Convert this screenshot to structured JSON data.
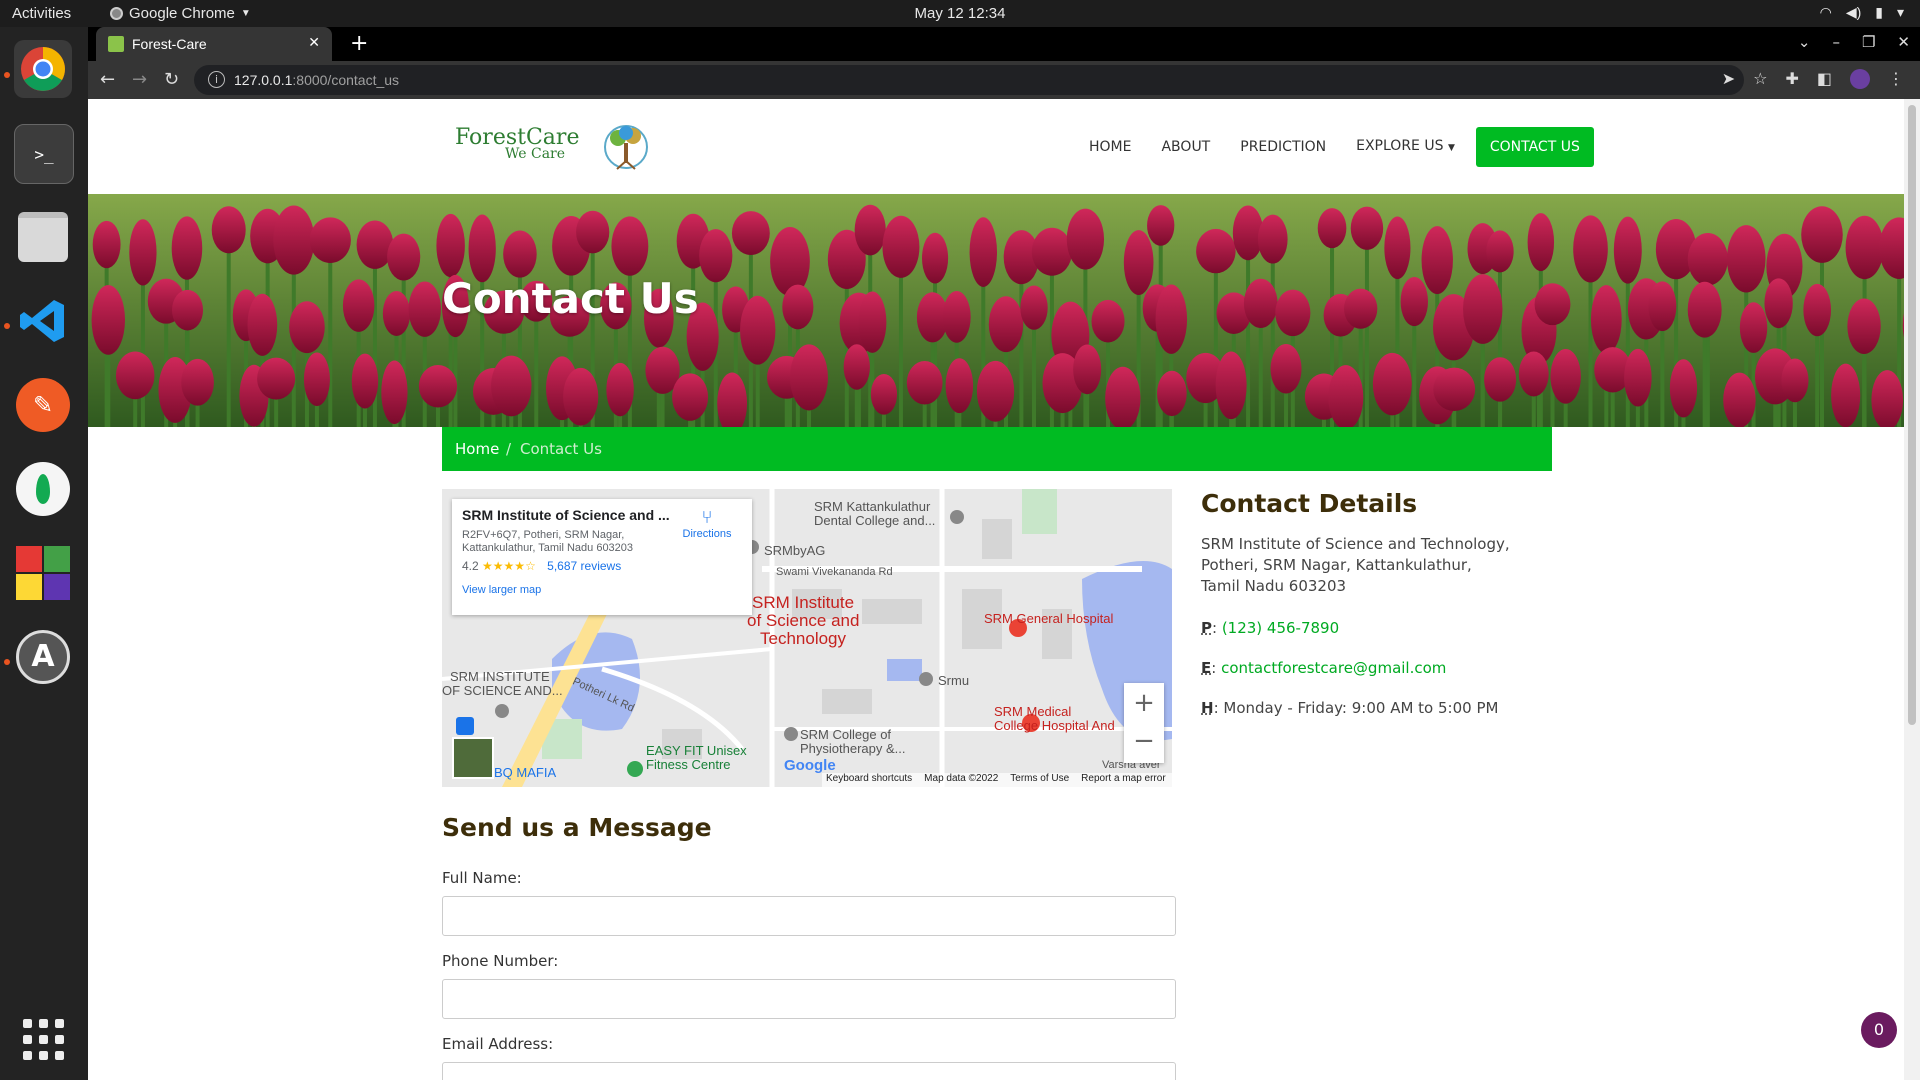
{
  "os": {
    "activities": "Activities",
    "app_name": "Google Chrome",
    "clock": "May 12  12:34"
  },
  "browser": {
    "tab_title": "Forest-Care",
    "url_host": "127.0.0.1",
    "url_path": ":8000/contact_us"
  },
  "site": {
    "logo_line1": "ForestCare",
    "logo_line2": "We Care",
    "nav": {
      "home": "HOME",
      "about": "ABOUT",
      "prediction": "PREDICTION",
      "explore": "EXPLORE US",
      "contact": "CONTACT US"
    },
    "hero_title": "Contact Us",
    "breadcrumb": {
      "home": "Home",
      "sep": "/",
      "current": "Contact Us"
    }
  },
  "map": {
    "place_name": "SRM Institute of Science and ...",
    "address_line1": "R2FV+6Q7, Potheri, SRM Nagar,",
    "address_line2": "Kattankulathur, Tamil Nadu 603203",
    "rating": "4.2",
    "stars": "★★★★☆",
    "reviews": "5,687 reviews",
    "directions": "Directions",
    "larger_map": "View larger map",
    "labels": {
      "l1": "SRM Kattankulathur",
      "l2": "Dental College and...",
      "l3": "SRMbyAG",
      "l4": "Swami Vivekananda Rd",
      "l5": "SRM Institute",
      "l6": "of Science and",
      "l7": "Technology",
      "l8": "SRM General Hospital",
      "l9": "SRM INSTITUTE",
      "l10": "OF SCIENCE AND...",
      "l11": "Potheri Lk Rd",
      "l12": "Srmu",
      "l13": "SRM Medical",
      "l14": "College Hospital And",
      "l15": "SRM College of",
      "l16": "Physiotherapy &...",
      "l17": "EASY FIT Unisex",
      "l18": "Fitness Centre",
      "l19": "BQ MAFIA",
      "l20": "Varsha aver"
    },
    "google": "Google",
    "footer": {
      "shortcuts": "Keyboard shortcuts",
      "data": "Map data ©2022",
      "terms": "Terms of Use",
      "report": "Report a map error"
    }
  },
  "contact": {
    "title": "Contact Details",
    "addr1": "SRM Institute of Science and Technology,",
    "addr2": "Potheri, SRM Nagar, Kattankulathur,",
    "addr3": "Tamil Nadu 603203",
    "phone_label": "P",
    "phone": "(123) 456-7890",
    "email_label": "E",
    "email": "contactforestcare@gmail.com",
    "hours_label": "H",
    "hours": "Monday - Friday: 9:00 AM to 5:00 PM"
  },
  "form": {
    "title": "Send us a Message",
    "full_name": "Full Name:",
    "phone": "Phone Number:",
    "email": "Email Address:"
  },
  "badge_count": "0"
}
